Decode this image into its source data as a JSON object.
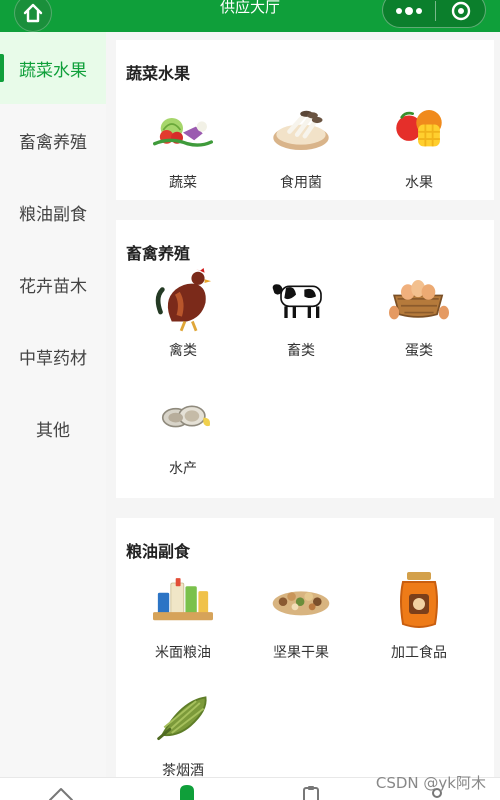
{
  "header": {
    "title": "供应大厅",
    "home_icon": "home-icon",
    "more_icon": "more-dots-icon",
    "close_icon": "target-close-icon",
    "bar_color": "#0f9f3a"
  },
  "sidebar": {
    "items": [
      {
        "label": "蔬菜水果",
        "active": true
      },
      {
        "label": "畜禽养殖",
        "active": false
      },
      {
        "label": "粮油副食",
        "active": false
      },
      {
        "label": "花卉苗木",
        "active": false
      },
      {
        "label": "中草药材",
        "active": false
      },
      {
        "label": "其他",
        "active": false
      }
    ]
  },
  "sections": [
    {
      "title": "蔬菜水果",
      "items": [
        {
          "label": "蔬菜",
          "icon": "vegetables-icon"
        },
        {
          "label": "食用菌",
          "icon": "mushroom-icon"
        },
        {
          "label": "水果",
          "icon": "fruit-icon"
        }
      ]
    },
    {
      "title": "畜禽养殖",
      "items": [
        {
          "label": "禽类",
          "icon": "rooster-icon"
        },
        {
          "label": "畜类",
          "icon": "cow-icon"
        },
        {
          "label": "蛋类",
          "icon": "eggs-icon"
        },
        {
          "label": "水产",
          "icon": "oyster-icon"
        }
      ]
    },
    {
      "title": "粮油副食",
      "items": [
        {
          "label": "米面粮油",
          "icon": "grain-oil-icon"
        },
        {
          "label": "坚果干果",
          "icon": "nuts-icon"
        },
        {
          "label": "加工食品",
          "icon": "jar-icon"
        },
        {
          "label": "茶烟酒",
          "icon": "tea-icon"
        }
      ]
    }
  ],
  "tabbar": {
    "tabs": [
      "home-tab-icon",
      "supply-tab-icon",
      "order-tab-icon",
      "profile-tab-icon"
    ]
  },
  "watermark": "CSDN @yk阿木"
}
